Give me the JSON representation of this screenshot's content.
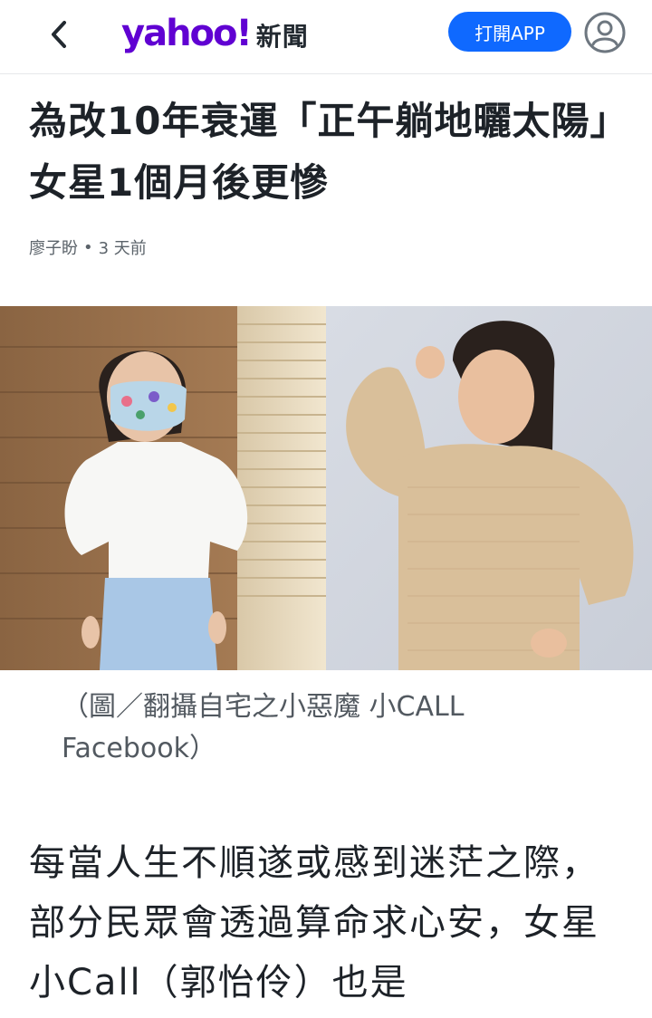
{
  "header": {
    "logo_word": "yahoo!",
    "logo_section": "新聞",
    "open_app_label": "打開APP",
    "brand_color": "#6001d2",
    "button_color": "#0f69ff"
  },
  "article": {
    "title": "為改10年衰運「正午躺地曬太陽」 女星1個月後更慘",
    "author": "廖子盼",
    "separator": "•",
    "time": "3 天前",
    "image_caption": "（圖／翻攝自宅之小惡魔 小CALL Facebook）",
    "body": "每當人生不順遂或感到迷茫之際，部分民眾會透過算命求心安，女星小Call（郭怡伶）也是"
  },
  "icons": {
    "back": "chevron-left-icon",
    "profile": "user-circle-icon"
  }
}
